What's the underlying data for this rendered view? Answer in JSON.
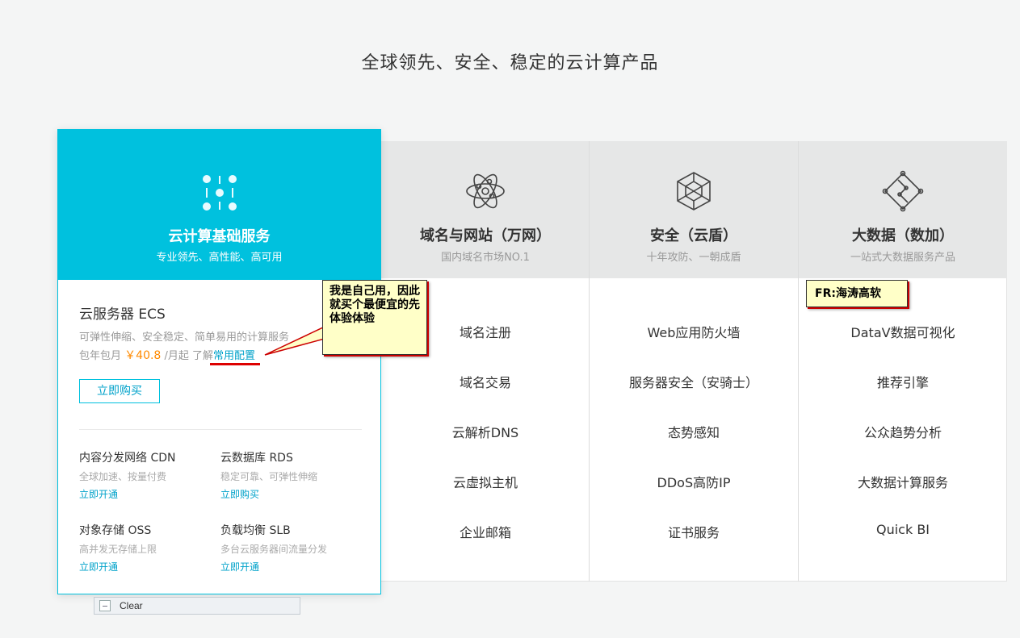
{
  "page_title": "全球领先、安全、稳定的云计算产品",
  "featured": {
    "icon": "dots-grid-icon",
    "title": "云计算基础服务",
    "subtitle": "专业领先、高性能、高可用",
    "ecs_title": "云服务器 ECS",
    "ecs_desc": "可弹性伸缩、安全稳定、简单易用的计算服务",
    "price_prefix": "包年包月",
    "price": "￥40.8",
    "price_suffix": "/月起",
    "learn_prefix": "了解",
    "learn_link": "常用配置",
    "buy_label": "立即购买",
    "products": [
      {
        "name": "内容分发网络 CDN",
        "desc": "全球加速、按量付费",
        "link": "立即开通"
      },
      {
        "name": "云数据库 RDS",
        "desc": "稳定可靠、可弹性伸缩",
        "link": "立即购买"
      },
      {
        "name": "对象存储 OSS",
        "desc": "高并发无存储上限",
        "link": "立即开通"
      },
      {
        "name": "负载均衡 SLB",
        "desc": "多台云服务器间流量分发",
        "link": "立即开通"
      }
    ]
  },
  "columns": [
    {
      "icon": "atom-icon",
      "title": "域名与网站（万网）",
      "subtitle": "国内域名市场NO.1",
      "items": [
        "域名注册",
        "域名交易",
        "云解析DNS",
        "云虚拟主机",
        "企业邮箱"
      ]
    },
    {
      "icon": "hexagon-network-icon",
      "title": "安全（云盾）",
      "subtitle": "十年攻防、一朝成盾",
      "items": [
        "Web应用防火墙",
        "服务器安全（安骑士）",
        "态势感知",
        "DDoS高防IP",
        "证书服务"
      ]
    },
    {
      "icon": "diamond-network-icon",
      "title": "大数据（数加）",
      "subtitle": "一站式大数据服务产品",
      "items": [
        "DataV数据可视化",
        "推荐引擎",
        "公众趋势分析",
        "大数据计算服务",
        "Quick BI"
      ]
    }
  ],
  "annotations": {
    "note1": "我是自己用，因此就买个最便宜的先体验体验",
    "note2": "FR:海涛高软"
  },
  "clear_label": "Clear",
  "colors": {
    "accent": "#00c1de",
    "price": "#ff8a00",
    "link": "#00a2ca"
  }
}
